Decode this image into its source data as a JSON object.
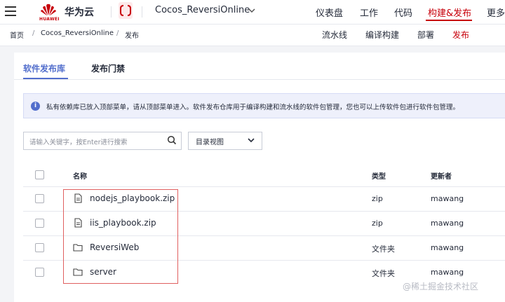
{
  "header": {
    "logo_text": "HUAWEI",
    "brand": "华为云",
    "project_name": "Cocos_ReversiOnline",
    "nav": [
      {
        "label": "仪表盘",
        "active": false
      },
      {
        "label": "工作",
        "active": false
      },
      {
        "label": "代码",
        "active": false
      },
      {
        "label": "构建&发布",
        "active": true
      },
      {
        "label": "更多",
        "active": false
      }
    ]
  },
  "breadcrumb": [
    "首页",
    "Cocos_ReversiOnline",
    "发布"
  ],
  "subnav": [
    {
      "label": "流水线",
      "active": false
    },
    {
      "label": "编译构建",
      "active": false
    },
    {
      "label": "部署",
      "active": false
    },
    {
      "label": "发布",
      "active": true
    }
  ],
  "tabs": [
    {
      "label": "软件发布库",
      "active": true
    },
    {
      "label": "发布门禁",
      "active": false
    }
  ],
  "notice": "私有依赖库已放入顶部菜单，请从顶部菜单进入。软件发布仓库用于编译构建和流水线的软件包管理，您也可以上传软件包进行软件包管理。",
  "search": {
    "placeholder": "请输入关键字，按Enter进行搜索"
  },
  "view_select": {
    "value": "目录视图"
  },
  "table": {
    "columns": [
      "名称",
      "类型",
      "更新者"
    ],
    "rows": [
      {
        "name": "nodejs_playbook.zip",
        "type": "zip",
        "updater": "mawang",
        "icon": "file-icon"
      },
      {
        "name": "iis_playbook.zip",
        "type": "zip",
        "updater": "mawang",
        "icon": "file-icon"
      },
      {
        "name": "ReversiWeb",
        "type": "文件夹",
        "updater": "mawang",
        "icon": "folder-icon"
      },
      {
        "name": "server",
        "type": "文件夹",
        "updater": "mawang",
        "icon": "folder-icon"
      }
    ]
  },
  "watermark": "@稀土掘金技术社区",
  "colors": {
    "accent": "#c7000b",
    "tab_active": "#526ecc",
    "highlight": "#e06060"
  }
}
